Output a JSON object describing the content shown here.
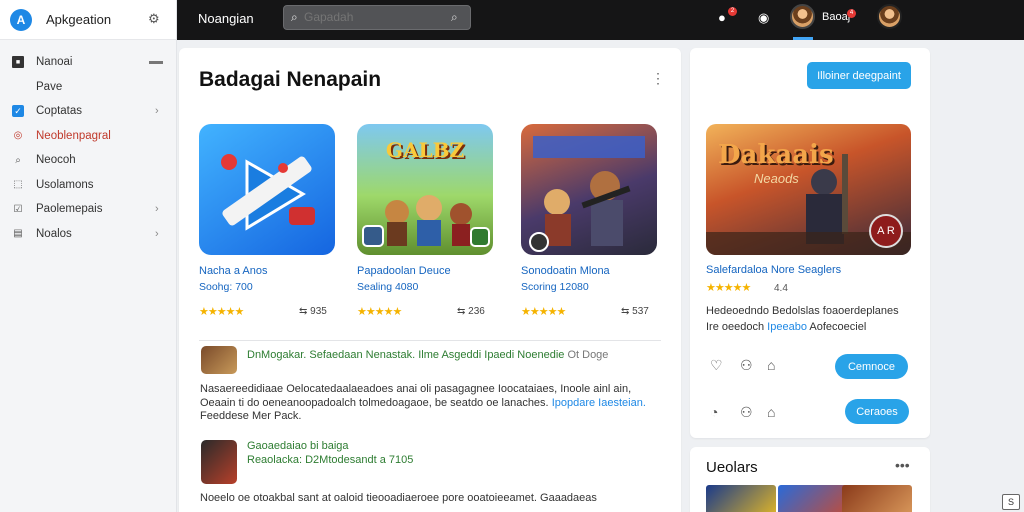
{
  "app": {
    "name": "Apkgeation",
    "logo_letter": "A",
    "icon": "gear-icon"
  },
  "sidebar": {
    "items": [
      {
        "label": "Nanoai",
        "icon": "dark-square-icon"
      },
      {
        "label": "Pave",
        "icon": "none"
      },
      {
        "label": "Coptatas",
        "icon": "checkbox-icon",
        "chevron": true
      },
      {
        "label": "Neoblenpagral",
        "icon": "chat-icon",
        "active": true
      },
      {
        "label": "Neocoh",
        "icon": "search-icon"
      },
      {
        "label": "Usolamons",
        "icon": "reply-icon"
      },
      {
        "label": "Paolemepais",
        "icon": "check-icon",
        "chevron": true
      },
      {
        "label": "Noalos",
        "icon": "list-icon",
        "chevron": true
      }
    ]
  },
  "topbar": {
    "title": "Noangian",
    "search_placeholder": "Gapadah",
    "user_name": "Baoaj",
    "notif_badge": "2",
    "user_badge": "4",
    "accent": "#42a5f5"
  },
  "main": {
    "title": "Badagai Nenapain",
    "tiles": [
      {
        "name": "Nacha a Anos",
        "sub": "Soohg: 700",
        "stars": "★★★★★",
        "share": "935",
        "art_title": ""
      },
      {
        "name": "Papadoolan Deuce",
        "sub": "Sealing 4080",
        "stars": "★★★★★",
        "share": "236",
        "art_title": "GALBZ"
      },
      {
        "name": "Sonodoatin Mlona",
        "sub": "Scoring 12080",
        "stars": "★★★★★",
        "share": "537",
        "art_title": ""
      }
    ],
    "posts": [
      {
        "head": "DnMogakar. Sefaedaan Nenastak. Ilme Asgeddi Ipaedi Noenedie",
        "meta": "Ot Doge",
        "body": "Nasaereedidiaae Oelocatedaalaeadoes anai oli pasagagnee Ioocataiaes, Inoole ainl ain, Oeaain ti do oeneanoopadoalch tolmedoagaoe, be seatdo oe lanaches.",
        "link": "Ipopdare Iaesteian.",
        "tail": "Feeddese Mer Pack."
      },
      {
        "head": "Gaoaedaiao bi baiga",
        "meta": "Reaolacka: D2Mtodesandt a 7105",
        "body": "Noeelo oe otoakbal sant at oaloid tieooadiaeroee pore ooatoieeamet. Gaaadaeas"
      }
    ]
  },
  "featured": {
    "button_top": "Illoiner deegpaint",
    "art_title": "Dakaais",
    "art_sub": "Neaods",
    "badge": "A R",
    "name": "Salefardaloa Nore Seaglers",
    "stars": "★★★★★",
    "rating": "4.4",
    "desc_a": "Hedeoedndo Bedolslas foaoerdeplanes",
    "desc_b": "Ire oeedoch",
    "desc_link": "Ipeeabo",
    "desc_c": "Aofecoeciel",
    "button_1": "Cemnoce",
    "button_2": "Ceraoes"
  },
  "related": {
    "title": "Ueolars"
  },
  "corner": {
    "label": "S"
  }
}
